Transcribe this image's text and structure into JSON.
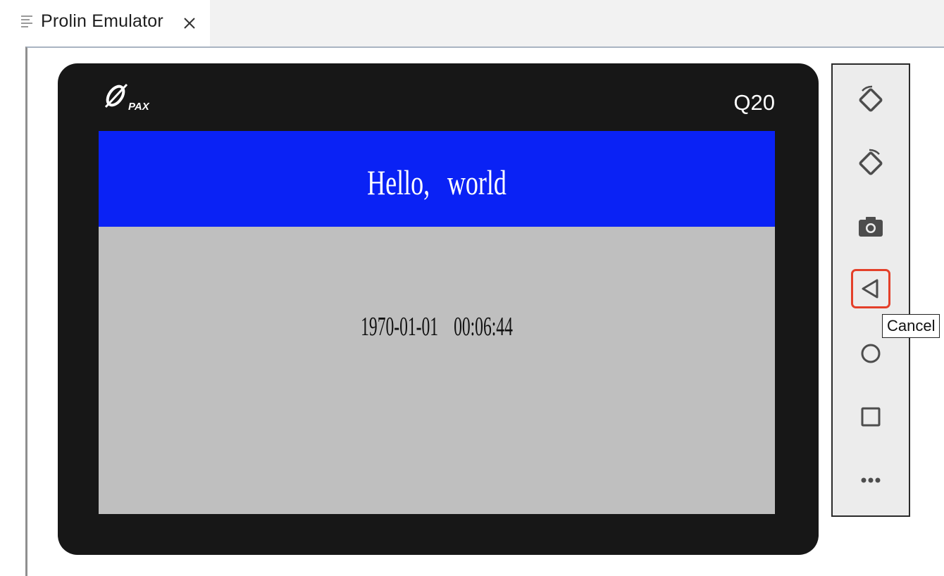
{
  "tab": {
    "title": "Prolin Emulator"
  },
  "device": {
    "brand": "PAX",
    "model": "Q20",
    "screen": {
      "header_text": "Hello, world",
      "datetime": "1970-01-01 00:06:44",
      "header_color": "#0a22f5",
      "body_color": "#bfbfbf"
    }
  },
  "toolbar": {
    "tools": [
      {
        "name": "rotate-left",
        "icon": "rotate-left-icon"
      },
      {
        "name": "rotate-right",
        "icon": "rotate-right-icon"
      },
      {
        "name": "screenshot",
        "icon": "camera-icon"
      },
      {
        "name": "back",
        "icon": "back-triangle-icon",
        "active": true
      },
      {
        "name": "home",
        "icon": "home-circle-icon"
      },
      {
        "name": "overview",
        "icon": "overview-square-icon"
      },
      {
        "name": "more",
        "icon": "more-dots-icon"
      }
    ],
    "tooltip": "Cancel",
    "accent_color": "#e4402a"
  }
}
